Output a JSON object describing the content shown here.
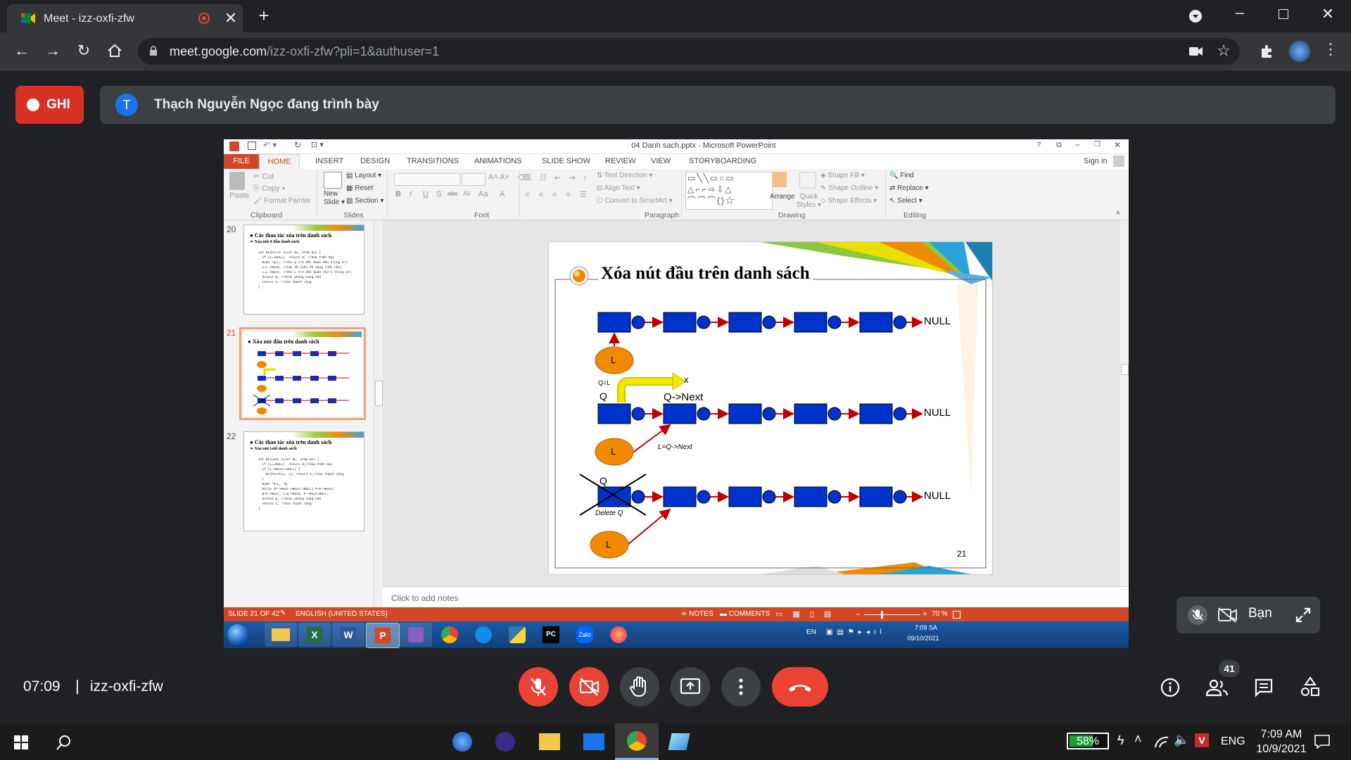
{
  "browser": {
    "tab_title": "Meet - izz-oxfi-zfw",
    "url_domain": "meet.google.com",
    "url_path": "/izz-oxfi-zfw?pli=1&authuser=1"
  },
  "meet": {
    "recording_label": "GHI",
    "presenter_avatar": "T",
    "presenter_text": "Thạch Nguyễn Ngọc đang trình bày",
    "self_label": "Bạn",
    "time": "07:09",
    "separator": "|",
    "meeting_code": "izz-oxfi-zfw",
    "participants_count": "41"
  },
  "powerpoint": {
    "title": "04 Danh sach.pptx - Microsoft PowerPoint",
    "help": "?",
    "tabs": [
      "FILE",
      "HOME",
      "INSERT",
      "DESIGN",
      "TRANSITIONS",
      "ANIMATIONS",
      "SLIDE SHOW",
      "REVIEW",
      "VIEW",
      "STORYBOARDING"
    ],
    "sign_in": "Sign in",
    "ribbon": {
      "paste": "Paste",
      "cut": "Cut",
      "copy": "Copy",
      "format_painter": "Format Painter",
      "clipboard": "Clipboard",
      "new_slide": "New",
      "new_slide2": "Slide",
      "layout": "Layout",
      "reset": "Reset",
      "section": "Section",
      "slides": "Slides",
      "bold": "B",
      "italic": "I",
      "underline": "U",
      "shadow": "S",
      "strike": "abc",
      "spacing": "AV",
      "case": "Aa",
      "color": "A",
      "font": "Font",
      "text_direction": "Text Direction",
      "align_text": "Align Text",
      "convert_smartart": "Convert to SmartArt",
      "paragraph": "Paragraph",
      "arrange": "Arrange",
      "quick": "Quick",
      "styles": "Styles",
      "shape_fill": "Shape Fill",
      "shape_outline": "Shape Outline",
      "shape_effects": "Shape Effects",
      "drawing": "Drawing",
      "find": "Find",
      "replace": "Replace",
      "select": "Select",
      "editing": "Editing"
    },
    "thumbs": [
      {
        "num": "20",
        "title": "Các thao tác xóa trên danh sách",
        "sub": "Xóa nút ở đầu danh sách",
        "code": [
          "int DelFirst (List &L, item &x) {",
          "  if (L==NULL)  return 0; //Xóa thất bại",
          "  Node *Q=L; //Cho Q trỏ đến Node đầu trong d/s",
          "  x=L->Data; //Lấy dữ liệu để dùng (nếu cần)",
          "  L=L->Next; //Cho L trỏ đến Node thứ 2 trong d/s",
          "  delete Q; //Giải phóng vùng nhớ",
          "  return 1; //Xóa thành công",
          "}"
        ]
      },
      {
        "num": "21",
        "title": "Xóa nút đầu trên danh sách"
      },
      {
        "num": "22",
        "title": "Các thao tác xóa trên danh sách",
        "sub": "Xóa nút cuối danh sách",
        "code": [
          "int DelLast (List &L, item &x) {",
          "  if (L==NULL)  return 0;//Xóa thất bại",
          "  if (L->Next==NULL) {",
          "    DelFirst(L, x); return 1;//Xóa thành công",
          "  }",
          "  Node *P=L, *Q;",
          "  while (P->Next->Next!=NULL) P=P->Next;",
          "  Q=P->Next; x=Q->Data; P->Next=NULL;",
          "  delete Q; //Giải phóng vùng nhớ",
          "  return 1; //Xóa thành công",
          "}"
        ]
      }
    ],
    "slide": {
      "title": "Xóa nút đầu trên danh sách",
      "null1": "NULL",
      "null2": "NULL",
      "null3": "NULL",
      "L": "L",
      "QL": "Q=L",
      "Q": "Q",
      "x": "x",
      "qnext": "Q->Next",
      "lqnext": "L=Q->Next",
      "deleteq": "Delete Q",
      "page": "21"
    },
    "notes_placeholder": "Click to add notes",
    "status": {
      "slide": "SLIDE 21 OF 42",
      "language": "ENGLISH (UNITED STATES)",
      "notes": "NOTES",
      "comments": "COMMENTS",
      "zoom": "70 %"
    },
    "win7": {
      "lang": "EN",
      "time": "7:09 SA",
      "date": "09/10/2021",
      "zalo": "Zalo"
    }
  },
  "windows": {
    "battery": "58%",
    "lang": "ENG",
    "time": "7:09 AM",
    "date": "10/9/2021"
  },
  "colors": {
    "meet_bg": "#202124",
    "record_red": "#d93025",
    "ppt_orange": "#d24726",
    "node_blue": "#0033cc",
    "node_orange": "#f08a00",
    "arrow_red": "#c00000"
  }
}
